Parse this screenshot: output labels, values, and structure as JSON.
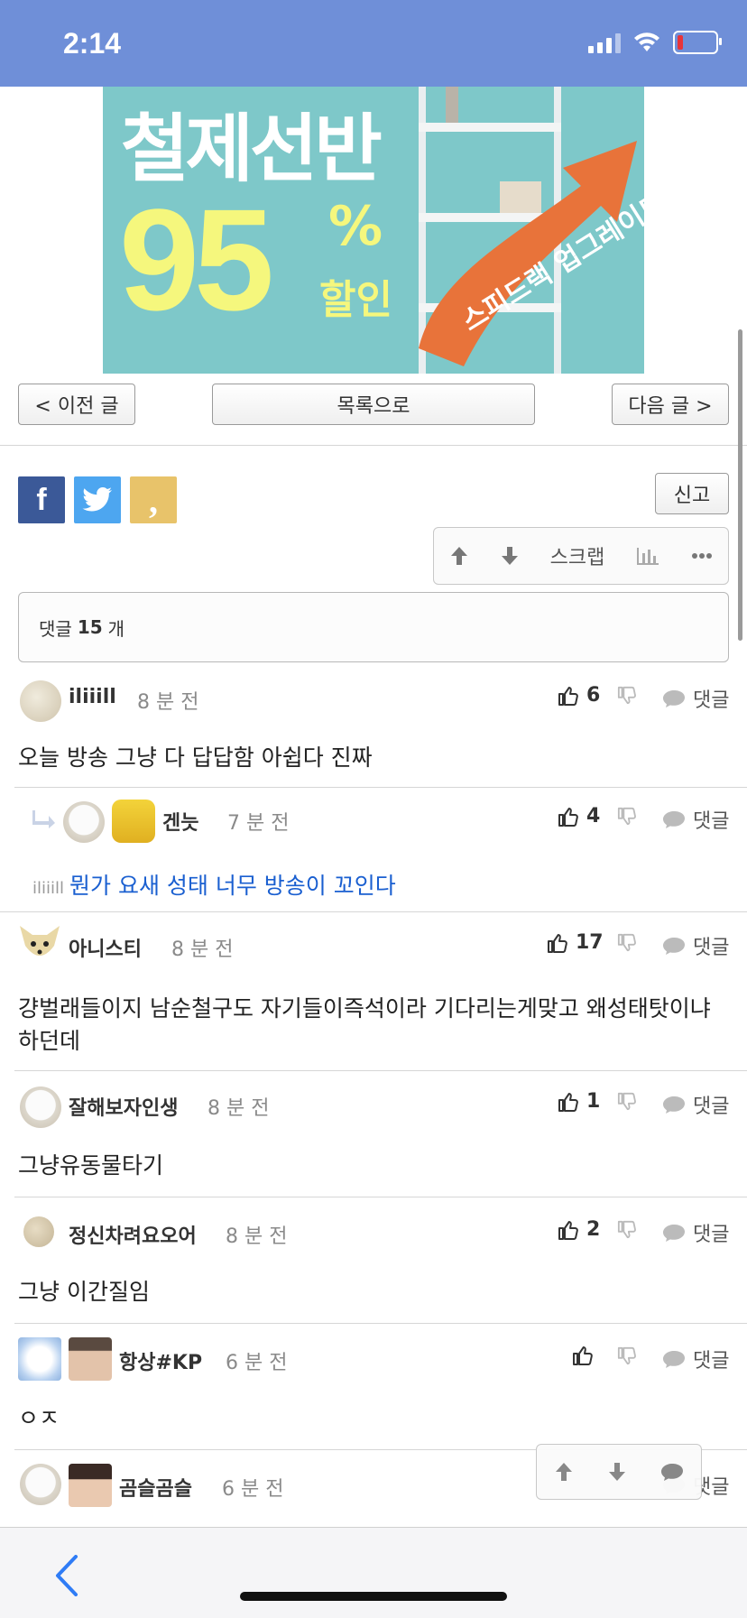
{
  "status": {
    "time": "2:14"
  },
  "ad": {
    "title": "철제선반",
    "number": "95",
    "percent": "%",
    "discount": "할인",
    "arrow_text": "스피드랙 업그레이드",
    "colors": {
      "background": "#7ec8c9",
      "highlight": "#f5f77d",
      "arrow": "#e8733a"
    }
  },
  "nav": {
    "prev": "< 이전 글",
    "list": "목록으로",
    "next": "다음 글 >"
  },
  "share": {
    "facebook": "f",
    "kakao": ","
  },
  "report": "신고",
  "actions": {
    "scrap": "스크랩"
  },
  "comment_count": {
    "prefix": "댓글",
    "count": "15",
    "suffix": "개"
  },
  "comments": [
    {
      "nick": "iliiill",
      "time": "8 분 전",
      "likes": "6",
      "reply": "댓글",
      "body": "오늘 방송 그냥 다 답답함 아쉽다 진짜"
    },
    {
      "nick": "겐늣",
      "time": "7 분 전",
      "likes": "4",
      "reply": "댓글",
      "mention": "iliiill",
      "body": "뭔가 요새 성태 너무 방송이 꼬인다"
    },
    {
      "nick": "아니스티",
      "time": "8 분 전",
      "likes": "17",
      "reply": "댓글",
      "body": "걍벌래들이지 남순철구도 자기들이즉석이라 기다리는게맞고 왜성태탓이냐하던데"
    },
    {
      "nick": "잘해보자인생",
      "time": "8 분 전",
      "likes": "1",
      "reply": "댓글",
      "body": "그냥유동물타기"
    },
    {
      "nick": "정신차려요오어",
      "time": "8 분 전",
      "likes": "2",
      "reply": "댓글",
      "body": "그냥 이간질임"
    },
    {
      "nick": "항상#KP",
      "time": "6 분 전",
      "likes": "",
      "reply": "댓글",
      "body": "ㅇㅈ"
    },
    {
      "nick": "곰슬곰슬",
      "time": "6 분 전",
      "likes": "",
      "reply": "댓글"
    }
  ],
  "theme": {
    "status_bar": "#6f8fd8",
    "link_blue": "#1a5fd0",
    "facebook": "#3b5998",
    "twitter": "#1da1f2",
    "kakao": "#e8c36a"
  }
}
